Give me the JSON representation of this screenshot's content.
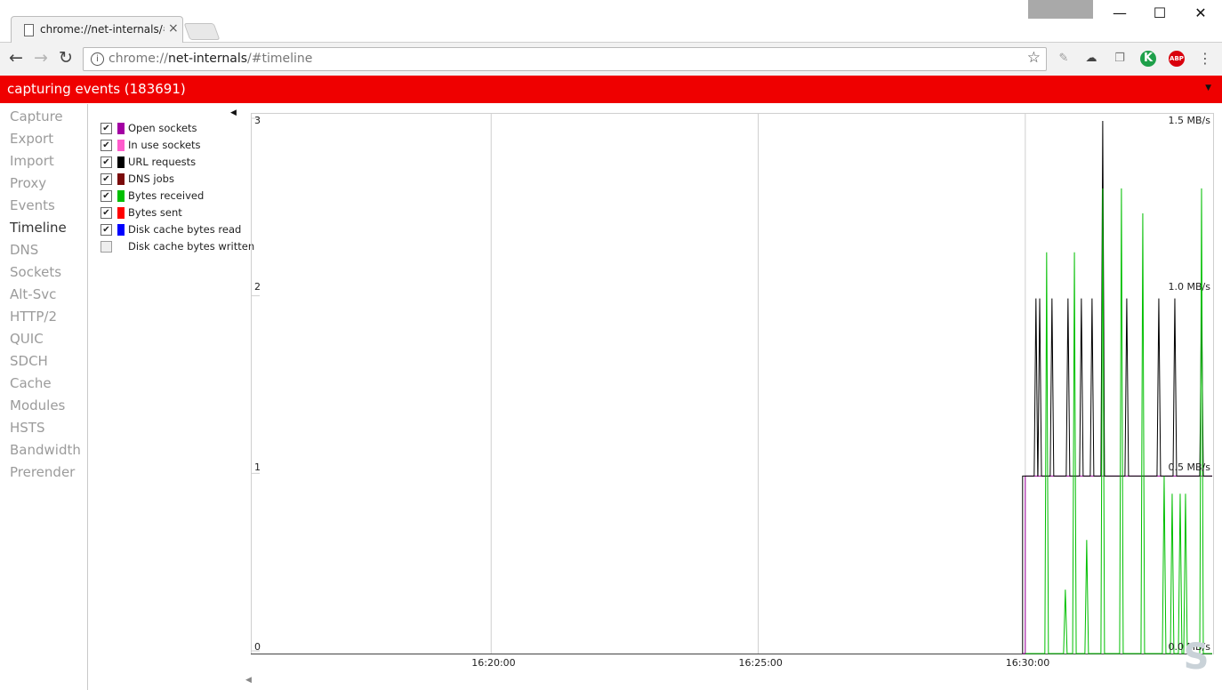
{
  "tab": {
    "title": "chrome://net-internals/#",
    "close": "×"
  },
  "window_controls": {
    "minimize": "—",
    "maximize": "☐",
    "close": "✕"
  },
  "address": {
    "scheme": "chrome://",
    "host": "net-internals",
    "path": "/#timeline"
  },
  "banner": {
    "text": "capturing events (183691)",
    "arrow": "▼"
  },
  "sidebar": {
    "items": [
      "Capture",
      "Export",
      "Import",
      "Proxy",
      "Events",
      "Timeline",
      "DNS",
      "Sockets",
      "Alt-Svc",
      "HTTP/2",
      "QUIC",
      "SDCH",
      "Cache",
      "Modules",
      "HSTS",
      "Bandwidth",
      "Prerender"
    ],
    "active": "Timeline"
  },
  "legend": [
    {
      "label": "Open sockets",
      "color": "#a300a3",
      "checked": true
    },
    {
      "label": "In use sockets",
      "color": "#ff5ccc",
      "checked": true
    },
    {
      "label": "URL requests",
      "color": "#000000",
      "checked": true
    },
    {
      "label": "DNS jobs",
      "color": "#7a0a0a",
      "checked": true
    },
    {
      "label": "Bytes received",
      "color": "#00bf00",
      "checked": true
    },
    {
      "label": "Bytes sent",
      "color": "#ff0000",
      "checked": true
    },
    {
      "label": "Disk cache bytes read",
      "color": "#0000ff",
      "checked": true
    },
    {
      "label": "Disk cache bytes written",
      "color": "",
      "checked": false
    }
  ],
  "chart_data": {
    "type": "line",
    "left_axis": {
      "ticks": [
        "0",
        "1",
        "2",
        "3"
      ],
      "ylim": [
        0,
        3
      ]
    },
    "right_axis": {
      "ticks": [
        "0.0 MB/s",
        "0.5 MB/s",
        "1.0 MB/s",
        "1.5 MB/s"
      ],
      "ylim": [
        0,
        1.5
      ]
    },
    "x_ticks": [
      "16:20:00",
      "16:25:00",
      "16:30:00"
    ],
    "xlim_minutes": [
      15.5,
      33.5
    ],
    "x_tick_minutes": [
      20,
      25,
      30
    ],
    "series": [
      {
        "name": "Open sockets",
        "color": "#a300a3",
        "axis": "left",
        "step": true,
        "points": [
          [
            29.95,
            0
          ],
          [
            30.0,
            1
          ],
          [
            33.5,
            1
          ]
        ]
      },
      {
        "name": "URL requests",
        "color": "#000000",
        "axis": "left",
        "spikes": true,
        "baseline": 1,
        "x": [
          30.2,
          30.27,
          30.5,
          30.8,
          31.05,
          31.25,
          31.45,
          31.9,
          32.5,
          32.8,
          33.3
        ],
        "y": [
          2,
          2,
          2,
          2,
          2,
          2,
          3,
          2,
          2,
          2,
          2
        ]
      },
      {
        "name": "Bytes received",
        "color": "#00bf00",
        "axis": "right",
        "spikes": true,
        "baseline": 0,
        "x": [
          30.4,
          30.75,
          30.92,
          31.15,
          31.45,
          31.8,
          32.2,
          32.6,
          32.75,
          32.9,
          33.0,
          33.3
        ],
        "y": [
          1.13,
          0.18,
          1.13,
          0.32,
          1.31,
          1.31,
          1.24,
          0.5,
          0.45,
          0.45,
          0.45,
          1.31
        ]
      }
    ]
  }
}
